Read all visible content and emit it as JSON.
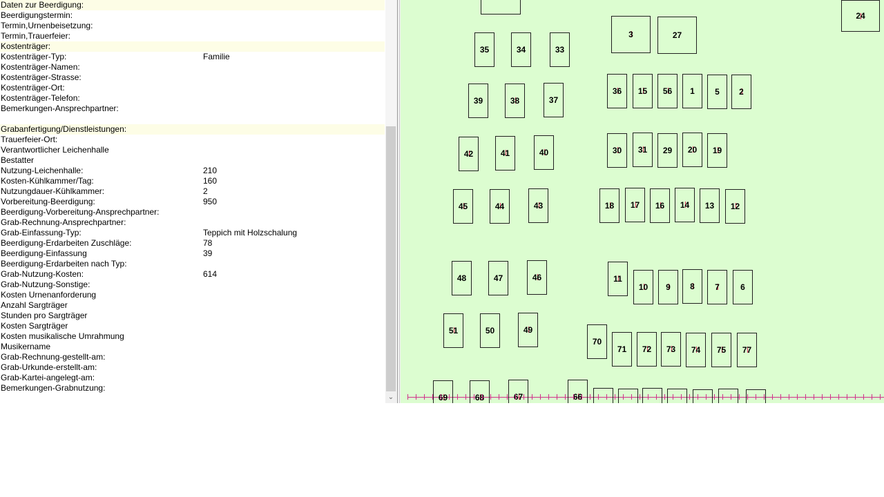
{
  "form": {
    "rows": [
      {
        "label": "Daten zur Beerdigung:",
        "value": "",
        "section": true
      },
      {
        "label": "Beerdigungstermin:",
        "value": ""
      },
      {
        "label": "Termin,Urnenbeisetzung:",
        "value": ""
      },
      {
        "label": "Termin,Trauerfeier:",
        "value": ""
      },
      {
        "label": "Kostenträger:",
        "value": "",
        "section": true
      },
      {
        "label": "Kostenträger-Typ:",
        "value": "Familie"
      },
      {
        "label": "Kostenträger-Namen:",
        "value": ""
      },
      {
        "label": "Kostenträger-Strasse:",
        "value": ""
      },
      {
        "label": "Kostenträger-Ort:",
        "value": ""
      },
      {
        "label": "Kostenträger-Telefon:",
        "value": ""
      },
      {
        "label": "Bemerkungen-Ansprechpartner:",
        "value": ""
      },
      {
        "label": "",
        "value": ""
      },
      {
        "label": "Grabanfertigung/Dienstleistungen:",
        "value": "",
        "section": true
      },
      {
        "label": "Trauerfeier-Ort:",
        "value": ""
      },
      {
        "label": "Verantwortlicher Leichenhalle",
        "value": ""
      },
      {
        "label": "Bestatter",
        "value": ""
      },
      {
        "label": "Nutzung-Leichenhalle:",
        "value": "210"
      },
      {
        "label": "Kosten-Kühlkammer/Tag:",
        "value": "160"
      },
      {
        "label": "Nutzungdauer-Kühlkammer:",
        "value": "2"
      },
      {
        "label": "Vorbereitung-Beerdigung:",
        "value": "950"
      },
      {
        "label": "Beerdigung-Vorbereitung-Ansprechpartner:",
        "value": ""
      },
      {
        "label": "Grab-Rechnung-Ansprechpartner:",
        "value": ""
      },
      {
        "label": "Grab-Einfassung-Typ:",
        "value": "Teppich mit Holzschalung"
      },
      {
        "label": "Beerdigung-Erdarbeiten Zuschläge:",
        "value": "78"
      },
      {
        "label": "Beerdigung-Einfassung",
        "value": "39"
      },
      {
        "label": "Beerdigung-Erdarbeiten nach Typ:",
        "value": ""
      },
      {
        "label": "Grab-Nutzung-Kosten:",
        "value": "614"
      },
      {
        "label": "Grab-Nutzung-Sonstige:",
        "value": ""
      },
      {
        "label": "Kosten Urnenanforderung",
        "value": ""
      },
      {
        "label": "Anzahl Sargträger",
        "value": ""
      },
      {
        "label": "Stunden pro Sargträger",
        "value": ""
      },
      {
        "label": "Kosten Sargträger",
        "value": ""
      },
      {
        "label": "Kosten musikalische Umrahmung",
        "value": ""
      },
      {
        "label": "Musikername",
        "value": ""
      },
      {
        "label": "Grab-Rechnung-gestellt-am:",
        "value": ""
      },
      {
        "label": "Grab-Urkunde-erstellt-am:",
        "value": ""
      },
      {
        "label": "Grab-Kartei-angelegt-am:",
        "value": ""
      },
      {
        "label": "Bemerkungen-Grabnutzung:",
        "value": ""
      }
    ]
  },
  "scrollbar": {
    "down_arrow": "⌄"
  },
  "map": {
    "colors": {
      "background": "#dcfdd0",
      "marker": "#e0305a",
      "boundary": "#d0308a"
    },
    "plots": [
      {
        "n": "33",
        "m": false
      },
      {
        "n": "34",
        "m": false
      },
      {
        "n": "35",
        "m": false
      },
      {
        "n": "3",
        "m": true
      },
      {
        "n": "27",
        "m": false
      },
      {
        "n": "24",
        "m": true
      },
      {
        "n": "39",
        "m": false
      },
      {
        "n": "38",
        "m": true
      },
      {
        "n": "37",
        "m": false
      },
      {
        "n": "36",
        "m": true
      },
      {
        "n": "15",
        "m": true
      },
      {
        "n": "56",
        "m": true
      },
      {
        "n": "1",
        "m": false
      },
      {
        "n": "5",
        "m": false
      },
      {
        "n": "2",
        "m": true
      },
      {
        "n": "42",
        "m": true
      },
      {
        "n": "41",
        "m": true
      },
      {
        "n": "40",
        "m": true
      },
      {
        "n": "30",
        "m": true
      },
      {
        "n": "31",
        "m": true
      },
      {
        "n": "29",
        "m": false
      },
      {
        "n": "20",
        "m": true
      },
      {
        "n": "19",
        "m": true
      },
      {
        "n": "45",
        "m": true
      },
      {
        "n": "44",
        "m": true
      },
      {
        "n": "43",
        "m": true
      },
      {
        "n": "18",
        "m": true
      },
      {
        "n": "17",
        "m": true
      },
      {
        "n": "16",
        "m": true
      },
      {
        "n": "14",
        "m": true
      },
      {
        "n": "13",
        "m": false
      },
      {
        "n": "12",
        "m": true
      },
      {
        "n": "48",
        "m": false
      },
      {
        "n": "47",
        "m": false
      },
      {
        "n": "46",
        "m": true
      },
      {
        "n": "11",
        "m": true
      },
      {
        "n": "10",
        "m": true
      },
      {
        "n": "9",
        "m": true
      },
      {
        "n": "8",
        "m": true
      },
      {
        "n": "7",
        "m": true
      },
      {
        "n": "6",
        "m": false
      },
      {
        "n": "51",
        "m": true
      },
      {
        "n": "50",
        "m": false
      },
      {
        "n": "49",
        "m": true
      },
      {
        "n": "70",
        "m": false
      },
      {
        "n": "71",
        "m": false
      },
      {
        "n": "72",
        "m": true
      },
      {
        "n": "73",
        "m": true
      },
      {
        "n": "74",
        "m": true
      },
      {
        "n": "75",
        "m": true
      },
      {
        "n": "77",
        "m": true
      },
      {
        "n": "69",
        "m": true
      },
      {
        "n": "68",
        "m": true
      },
      {
        "n": "67",
        "m": true
      },
      {
        "n": "66",
        "m": true
      },
      {
        "n": "",
        "m": false
      },
      {
        "n": "",
        "m": false
      },
      {
        "n": "",
        "m": false
      },
      {
        "n": "",
        "m": false
      },
      {
        "n": "",
        "m": false
      },
      {
        "n": "",
        "m": false
      },
      {
        "n": "",
        "m": false
      },
      {
        "n": "",
        "m": false
      }
    ]
  }
}
